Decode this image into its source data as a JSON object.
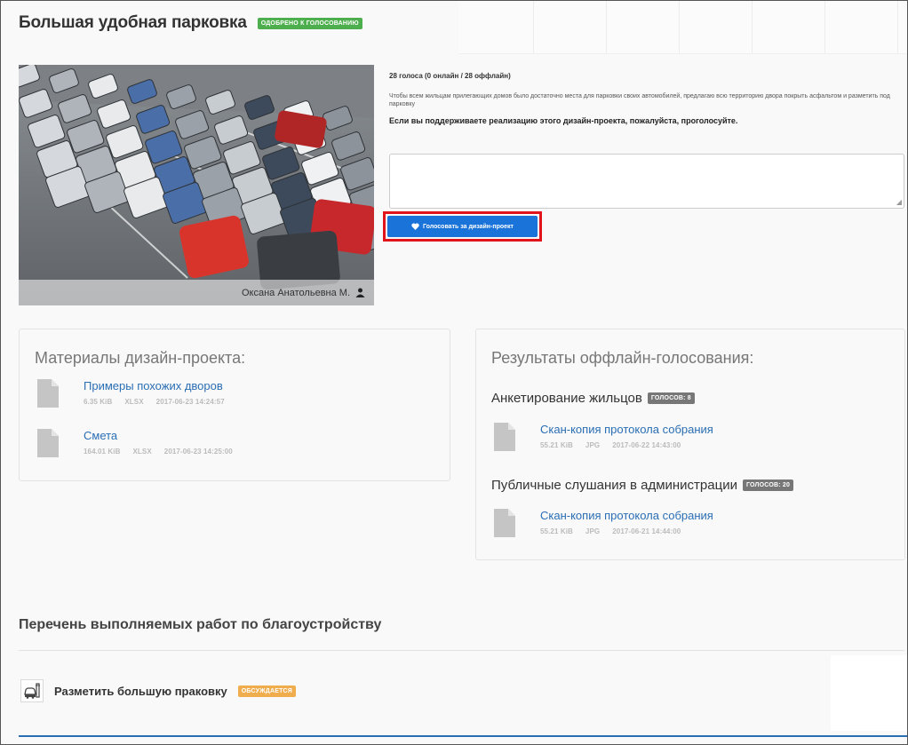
{
  "project": {
    "title": "Большая удобная парковка",
    "status_badge": "ОДОБРЕНО К ГОЛОСОВАНИЮ",
    "author": "Оксана Анатольевна М.",
    "votes_summary": "28 голоса (0 онлайн / 28 оффлайн)",
    "description": "Чтобы всем жильцам прилегающих домов было достаточно места для парковки своих автомобилей, предлагаю всю территорию двора покрыть асфальтом и разметить под парковку",
    "call_to_action": "Если вы поддерживаете реализацию этого дизайн-проекта, пожалуйста, проголосуйте.",
    "comment_value": "",
    "vote_button_label": "Голосовать за дизайн-проект"
  },
  "materials": {
    "title": "Материалы дизайн-проекта:",
    "files": [
      {
        "name": "Примеры похожих дворов",
        "size": "6.35 KiB",
        "type": "XLSX",
        "date": "2017-06-23 14:24:57"
      },
      {
        "name": "Смета",
        "size": "164.01 KiB",
        "type": "XLSX",
        "date": "2017-06-23 14:25:00"
      }
    ]
  },
  "offline_results": {
    "title": "Результаты оффлайн-голосования:",
    "groups": [
      {
        "title": "Анкетирование жильцов",
        "votes_badge": "ГОЛОСОВ: 8",
        "file": {
          "name": "Скан-копия протокола собрания",
          "size": "55.21 KiB",
          "type": "JPG",
          "date": "2017-06-22 14:43:00"
        }
      },
      {
        "title": "Публичные слушания в администрации",
        "votes_badge": "ГОЛОСОВ: 20",
        "file": {
          "name": "Скан-копия протокола собрания",
          "size": "55.21 KiB",
          "type": "JPG",
          "date": "2017-06-21 14:44:00"
        }
      }
    ]
  },
  "works": {
    "title": "Перечень выполняемых работ по благоустройству",
    "items": [
      {
        "label": "Разметить большую праковку",
        "badge": "ОБСУЖДАЕТСЯ",
        "icon": "car-wash-icon"
      }
    ]
  },
  "colors": {
    "accent": "#1a73d9",
    "link": "#2a6eb4",
    "approved": "#4cae4c",
    "discussing": "#f0ad4e",
    "highlight": "#e0141a"
  }
}
